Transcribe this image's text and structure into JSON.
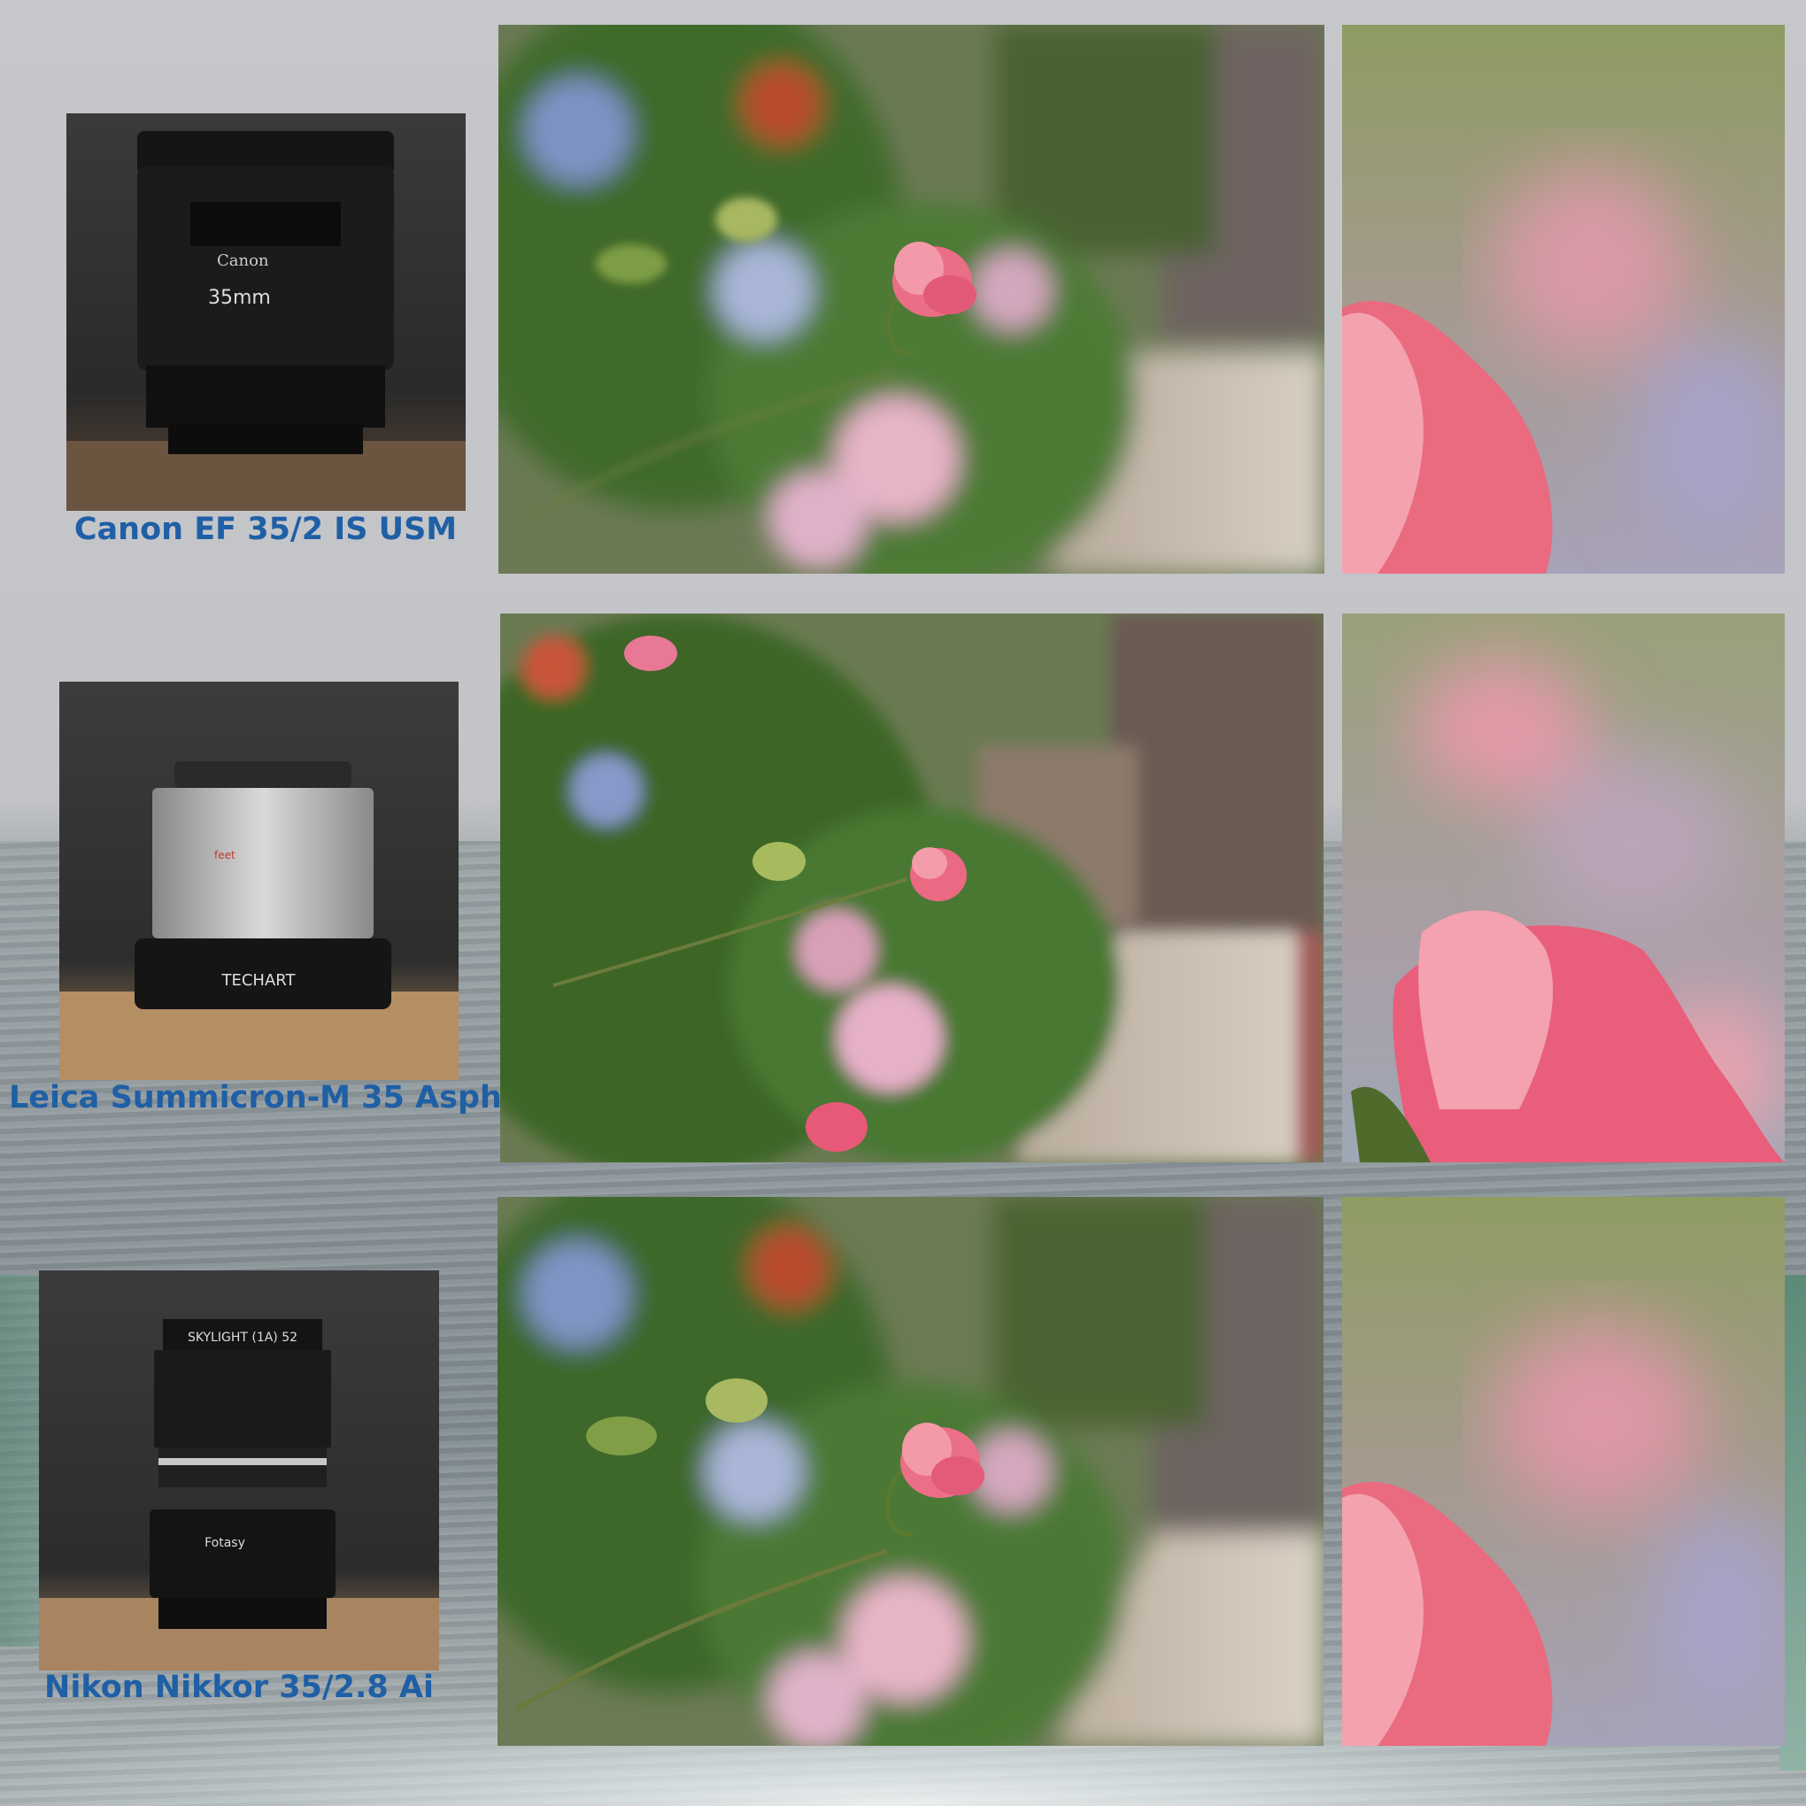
{
  "rows": [
    {
      "lens_name": "Canon EF 35/2 IS USM",
      "lens_body_text": "Canon",
      "lens_focal_text": "35mm"
    },
    {
      "lens_name": "Leica Summicron-M 35 Asph.",
      "lens_body_text": "TECHART",
      "lens_focal_text": "feet"
    },
    {
      "lens_name": "Nikon Nikkor 35/2.8 Ai",
      "lens_body_text": "Fotasy",
      "lens_focal_text": "SKYLIGHT (1A) 52"
    }
  ]
}
